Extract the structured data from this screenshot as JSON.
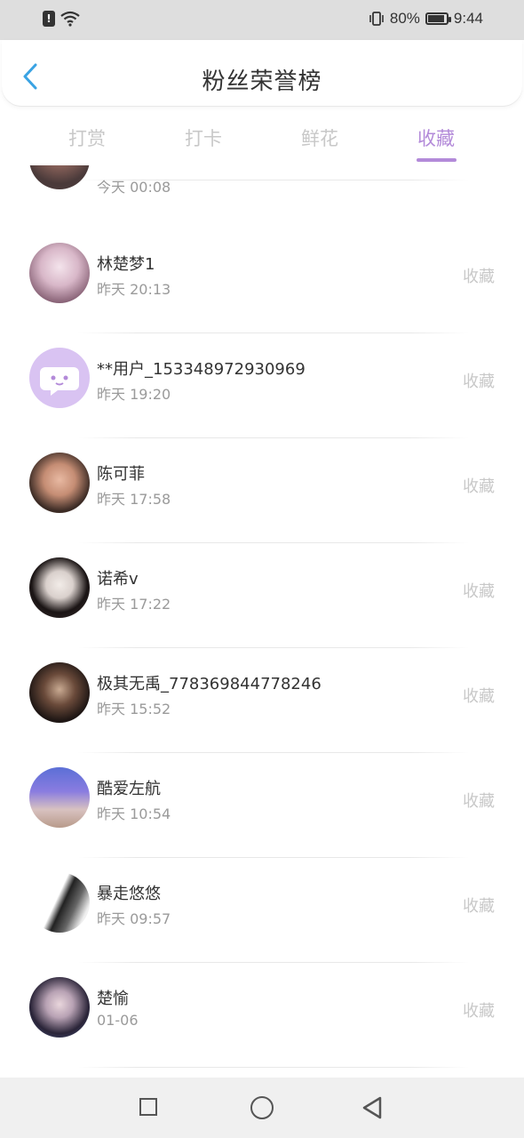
{
  "status_bar": {
    "battery_percent": "80%",
    "battery_level": 0.8,
    "time": "9:44"
  },
  "header": {
    "title": "粉丝荣誉榜"
  },
  "tabs": [
    {
      "label": "打赏",
      "active": false
    },
    {
      "label": "打卡",
      "active": false
    },
    {
      "label": "鲜花",
      "active": false
    },
    {
      "label": "收藏",
      "active": true
    }
  ],
  "list": {
    "partial_row": {
      "time": "今天 00:08"
    },
    "items": [
      {
        "name": "林楚梦1",
        "time": "昨天 20:13",
        "action": "收藏",
        "avatar": "avatar-illustration-icon"
      },
      {
        "name": "**用户_15334897293096​9",
        "time": "昨天 19:20",
        "action": "收藏",
        "avatar": "default-chat-avatar-icon"
      },
      {
        "name": "陈可菲",
        "time": "昨天 17:58",
        "action": "收藏",
        "avatar": "avatar-photo-icon"
      },
      {
        "name": "诺希v",
        "time": "昨天 17:22",
        "action": "收藏",
        "avatar": "avatar-photo-icon"
      },
      {
        "name": "极其无禹_778369844778246",
        "time": "昨天 15:52",
        "action": "收藏",
        "avatar": "avatar-anime-icon"
      },
      {
        "name": "酷爱左航",
        "time": "昨天 10:54",
        "action": "收藏",
        "avatar": "avatar-photo-icon"
      },
      {
        "name": "暴走悠悠",
        "time": "昨天 09:57",
        "action": "收藏",
        "avatar": "avatar-bw-icon"
      },
      {
        "name": "楚愉",
        "time": "01-06",
        "action": "收藏",
        "avatar": "avatar-photo-icon"
      }
    ]
  },
  "colors": {
    "accent": "#b38ad9",
    "muted": "#c8c8c8"
  }
}
